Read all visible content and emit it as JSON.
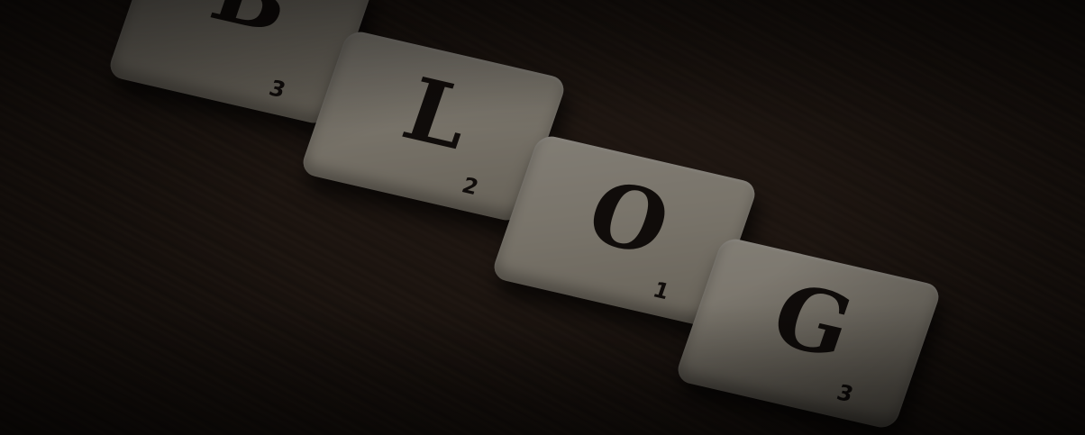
{
  "tiles": [
    {
      "letter": "B",
      "score": "3"
    },
    {
      "letter": "L",
      "score": "2"
    },
    {
      "letter": "O",
      "score": "1"
    },
    {
      "letter": "G",
      "score": "3"
    }
  ]
}
